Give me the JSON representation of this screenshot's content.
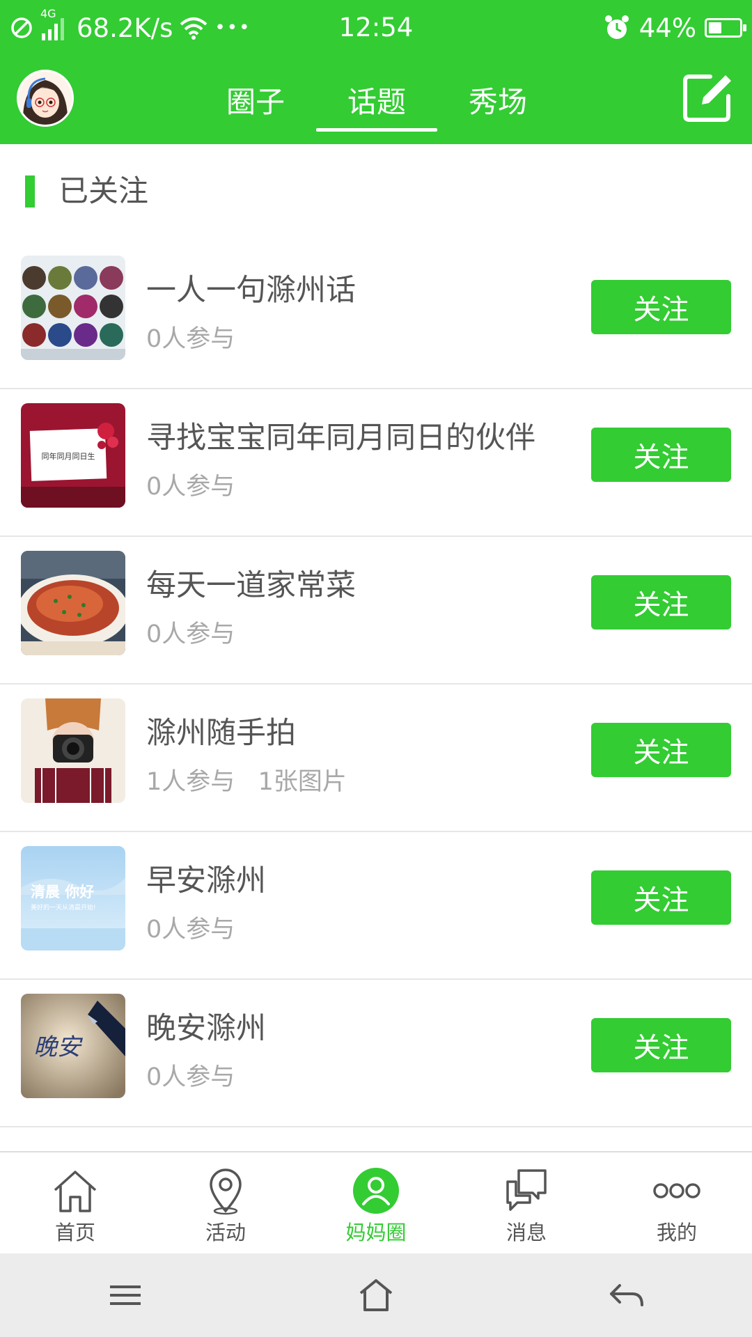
{
  "status_bar": {
    "network_speed": "68.2K/s",
    "network_type": "4G",
    "more": "•••",
    "time": "12:54",
    "battery": "44%",
    "battery_level": 0.44
  },
  "header": {
    "tabs": [
      {
        "label": "圈子",
        "active": false
      },
      {
        "label": "话题",
        "active": true
      },
      {
        "label": "秀场",
        "active": false
      }
    ]
  },
  "section": {
    "title": "已关注"
  },
  "topics": [
    {
      "title": "一人一句滁州话",
      "meta": "0人参与",
      "button": "关注",
      "thumb": "dialect-words-collage"
    },
    {
      "title": "寻找宝宝同年同月同日的伙伴",
      "meta": "0人参与",
      "button": "关注",
      "thumb": "red-card-image"
    },
    {
      "title": "每天一道家常菜",
      "meta": "0人参与",
      "button": "关注",
      "thumb": "food-dish-image"
    },
    {
      "title": "滁州随手拍",
      "meta": "1人参与   1张图片",
      "button": "关注",
      "thumb": "camera-girl-image"
    },
    {
      "title": "早安滁州",
      "meta": "0人参与",
      "button": "关注",
      "thumb": "good-morning-image"
    },
    {
      "title": "晚安滁州",
      "meta": "0人参与",
      "button": "关注",
      "thumb": "good-night-image"
    }
  ],
  "thumb_texts": {
    "card": "同年同月同日生",
    "morning_main": "清晨 你好",
    "morning_sub": "美好的一天从清晨开始!",
    "night": "晚安"
  },
  "tab_bar": [
    {
      "label": "首页",
      "icon": "home-icon",
      "active": false
    },
    {
      "label": "活动",
      "icon": "location-pin-icon",
      "active": false
    },
    {
      "label": "妈妈圈",
      "icon": "person-circle-icon",
      "active": true
    },
    {
      "label": "消息",
      "icon": "chat-bubbles-icon",
      "active": false
    },
    {
      "label": "我的",
      "icon": "three-dots-icon",
      "active": false
    }
  ],
  "colors": {
    "brand_green": "#33cc33",
    "text_primary": "#555555",
    "text_secondary": "#a8a8a8"
  }
}
